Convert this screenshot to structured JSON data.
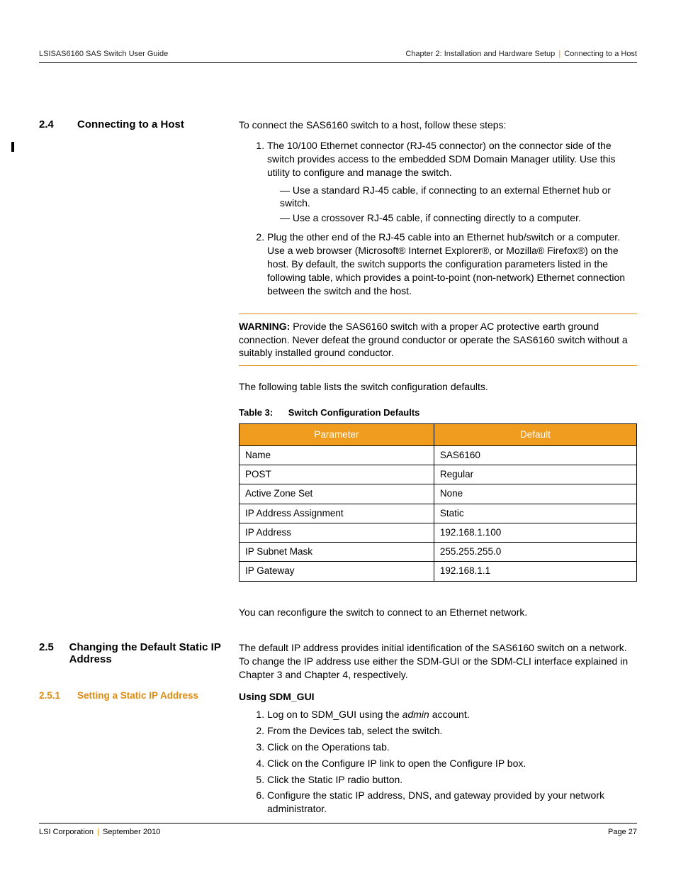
{
  "header": {
    "left": "LSISAS6160 SAS Switch User Guide",
    "right_chapter": "Chapter 2: Installation and Hardware Setup",
    "right_section": "Connecting to a Host"
  },
  "sec24": {
    "num": "2.4",
    "title": "Connecting to a Host",
    "intro": "To connect the SAS6160 switch to a host, follow these steps:",
    "li1": "The 10/100 Ethernet connector (RJ-45 connector) on the connector side of the switch provides access to the embedded SDM Domain Manager utility. Use this utility to configure and manage the switch.",
    "li1a": "Use a standard RJ-45 cable, if connecting to an external Ethernet hub or switch.",
    "li1b": "Use a crossover RJ-45 cable, if connecting directly to a computer.",
    "li2": "Plug the other end of the RJ-45 cable into an Ethernet hub/switch or a computer. Use a web browser (Microsoft® Internet Explorer®, or Mozilla® Firefox®) on the host. By default, the switch supports the configuration parameters listed in the following table, which provides a point-to-point (non-network) Ethernet connection between the switch and the host.",
    "warning_label": "WARNING:",
    "warning_text": "  Provide the SAS6160 switch with a proper AC protective earth ground connection. Never defeat the ground conductor or operate the SAS6160 switch without a suitably installed ground conductor.",
    "after_warning": "The following table lists the switch configuration defaults.",
    "table_num": "Table 3:",
    "table_title": "Switch Configuration Defaults",
    "col1": "Parameter",
    "col2": "Default",
    "rows": [
      {
        "p": "Name",
        "d": "SAS6160"
      },
      {
        "p": "POST",
        "d": "Regular"
      },
      {
        "p": "Active Zone Set",
        "d": "None"
      },
      {
        "p": "IP Address Assignment",
        "d": "Static"
      },
      {
        "p": "IP Address",
        "d": "192.168.1.100"
      },
      {
        "p": "IP Subnet Mask",
        "d": "255.255.255.0"
      },
      {
        "p": "IP Gateway",
        "d": "192.168.1.1"
      }
    ],
    "post_table": "You can reconfigure the switch to connect to an Ethernet network."
  },
  "sec25": {
    "num": "2.5",
    "title": "Changing the Default Static IP Address",
    "intro": "The default IP address provides initial identification of the SAS6160 switch on a network. To change the IP address use either the SDM-GUI or the SDM-CLI interface explained in Chapter 3 and Chapter 4, respectively."
  },
  "sec251": {
    "num": "2.5.1",
    "title": "Setting a Static IP Address",
    "h": "Using SDM_GUI",
    "s1a": "Log on to SDM_GUI using the ",
    "s1i": "admin",
    "s1b": " account.",
    "s2": "From the Devices tab, select the switch.",
    "s3": "Click on the Operations tab.",
    "s4": "Click on the Configure IP link to open the Configure IP box.",
    "s5": "Click the Static IP radio button.",
    "s6": "Configure the static IP address, DNS, and gateway provided by your network administrator."
  },
  "footer": {
    "left_company": "LSI Corporation",
    "left_date": "September 2010",
    "right": "Page 27"
  }
}
